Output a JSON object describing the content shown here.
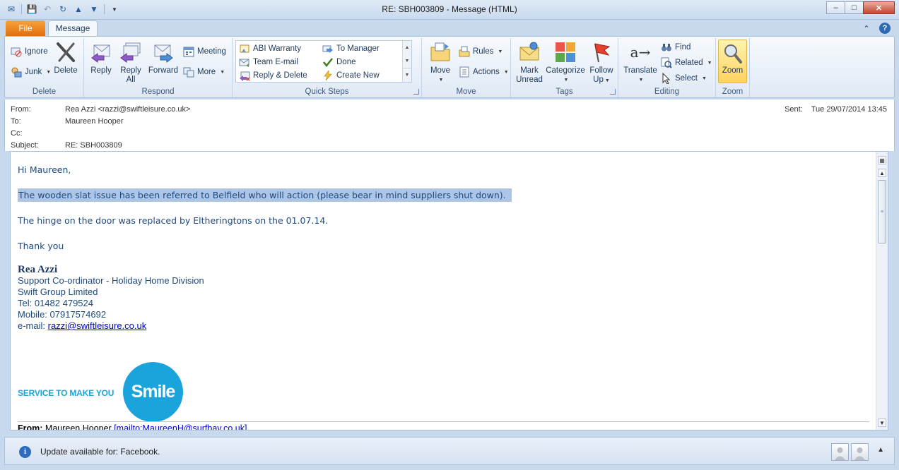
{
  "window": {
    "title": "RE: SBH003809  -  Message (HTML)",
    "minimize_label": "–",
    "maximize_label": "□",
    "close_label": "✕"
  },
  "tabs": {
    "file": "File",
    "message": "Message"
  },
  "ribbon": {
    "groups": {
      "delete": "Delete",
      "respond": "Respond",
      "quick_steps": "Quick Steps",
      "move": "Move",
      "tags": "Tags",
      "editing": "Editing",
      "zoom": "Zoom"
    },
    "ignore": "Ignore",
    "junk": "Junk",
    "delete_btn": "Delete",
    "reply": "Reply",
    "reply_all_1": "Reply",
    "reply_all_2": "All",
    "forward": "Forward",
    "meeting": "Meeting",
    "more": "More",
    "quick_steps": [
      "ABI Warranty",
      "To Manager",
      "Team E-mail",
      "Done",
      "Reply & Delete",
      "Create New"
    ],
    "move_btn": "Move",
    "rules": "Rules",
    "actions": "Actions",
    "mark_unread_1": "Mark",
    "mark_unread_2": "Unread",
    "categorize": "Categorize",
    "follow_up_1": "Follow",
    "follow_up_2": "Up",
    "translate": "Translate",
    "find": "Find",
    "related": "Related",
    "select": "Select",
    "zoom_btn": "Zoom"
  },
  "header": {
    "from_label": "From:",
    "from_value": "Rea Azzi <razzi@swiftleisure.co.uk>",
    "to_label": "To:",
    "to_value": "Maureen Hooper",
    "cc_label": "Cc:",
    "cc_value": "",
    "subject_label": "Subject:",
    "subject_value": "RE: SBH003809",
    "sent_label": "Sent:",
    "sent_value": "Tue 29/07/2014 13:45"
  },
  "body": {
    "greeting": "Hi Maureen,",
    "para1": "The wooden slat issue has been referred to Belfield who will action (please bear in mind suppliers shut down).",
    "para2": "The hinge on the door was replaced by Eltheringtons on the 01.07.14.",
    "thanks": "Thank you",
    "signature": {
      "name": "Rea Azzi",
      "title": "Support Co-ordinator - Holiday Home Division",
      "company": "Swift Group Limited",
      "tel": "Tel: 01482 479524",
      "mobile": "Mobile: 07917574692",
      "email_label": "e-mail: ",
      "email": "razzi@swiftleisure.co.uk"
    },
    "logo_tagline": "SERVICE TO MAKE YOU",
    "logo_word": "Smile",
    "next_from_label": "From:",
    "next_from_name": "Maureen Hooper",
    "next_from_link": "[mailto:MaureenH@surfbay.co.uk]"
  },
  "status": {
    "message": "Update available for: Facebook."
  }
}
